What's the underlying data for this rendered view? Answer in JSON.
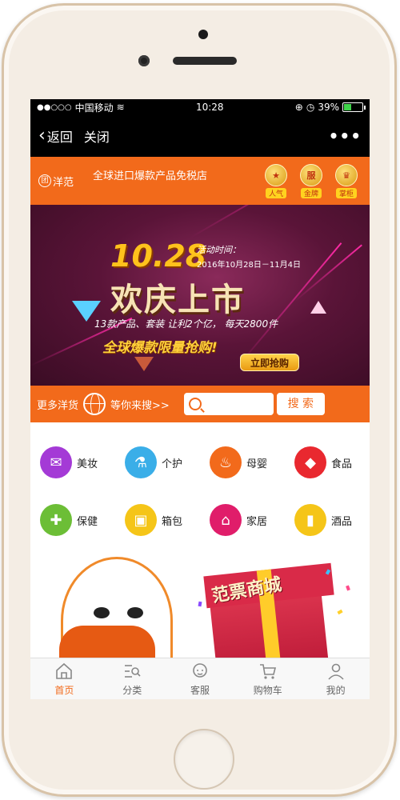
{
  "status_bar": {
    "carrier": "中国移动",
    "time": "10:28",
    "battery": "39%",
    "battery_level": 0.39
  },
  "nav": {
    "back_label": "返回",
    "close_label": "关闭",
    "more_glyph": "•••"
  },
  "brand": {
    "logo_text": "洋范",
    "logo_mark": "团",
    "slogan": "全球进口爆款产品免税店",
    "medals": [
      {
        "symbol": "★",
        "label": "人气"
      },
      {
        "symbol": "服",
        "label": "金牌"
      },
      {
        "symbol": "♛",
        "label": "掌柜"
      }
    ]
  },
  "banner": {
    "date": "10.28",
    "time_label": "活动时间：",
    "time_range": "2016年10月28日－11月4日",
    "title": "欢庆上市",
    "description": "13款产品、套装 让利2个亿， 每天2800件",
    "slogan": "全球爆款限量抢购!",
    "button": "立即抢购"
  },
  "search": {
    "left_text": "更多洋货",
    "right_text": "等你来搜>>",
    "placeholder": "",
    "button": "搜 索"
  },
  "categories": [
    {
      "label": "美妆",
      "icon": "makeup-icon",
      "color": "#a43ad6",
      "glyph": "✉"
    },
    {
      "label": "个护",
      "icon": "bottle-icon",
      "color": "#3aaee8",
      "glyph": "⚗"
    },
    {
      "label": "母婴",
      "icon": "baby-bottle-icon",
      "color": "#f26a1b",
      "glyph": "♨"
    },
    {
      "label": "食品",
      "icon": "drumstick-icon",
      "color": "#e9282f",
      "glyph": "◆"
    },
    {
      "label": "保健",
      "icon": "medicine-icon",
      "color": "#6cbe36",
      "glyph": "✚"
    },
    {
      "label": "箱包",
      "icon": "bag-icon",
      "color": "#f5c518",
      "glyph": "▣"
    },
    {
      "label": "家居",
      "icon": "sofa-icon",
      "color": "#e01d6a",
      "glyph": "⌂"
    },
    {
      "label": "酒品",
      "icon": "wine-icon",
      "color": "#f5c518",
      "glyph": "▮"
    }
  ],
  "promo": {
    "title": "范票商城"
  },
  "tabs": [
    {
      "label": "首页",
      "icon": "home-icon",
      "active": true
    },
    {
      "label": "分类",
      "icon": "category-icon",
      "active": false
    },
    {
      "label": "客服",
      "icon": "service-icon",
      "active": false
    },
    {
      "label": "购物车",
      "icon": "cart-icon",
      "active": false
    },
    {
      "label": "我的",
      "icon": "user-icon",
      "active": false
    }
  ],
  "colors": {
    "accent": "#f26a1b",
    "banner_bg": "#5a1438",
    "highlight": "#ffc21c"
  }
}
